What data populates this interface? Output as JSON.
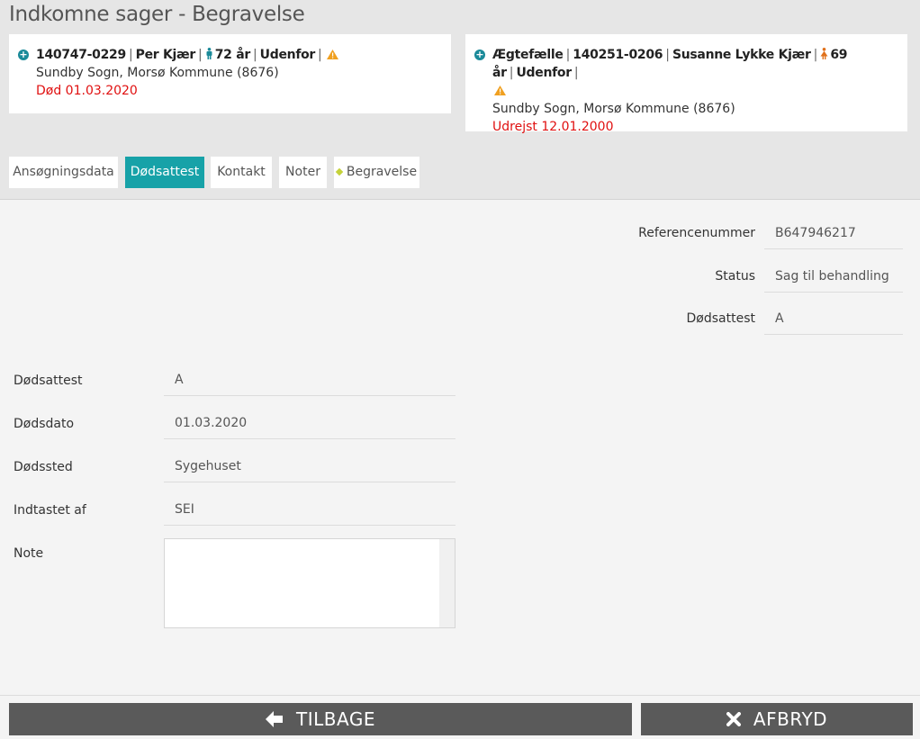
{
  "title": "Indkomne sager - Begravelse",
  "deceased": {
    "cpr": "140747-0229",
    "name": "Per Kjær",
    "age": "72 år",
    "location": "Udenfor",
    "parish": "Sundby Sogn, Morsø Kommune (8676)",
    "status": "Død 01.03.2020"
  },
  "spouse": {
    "relation": "Ægtefælle",
    "cpr": "140251-0206",
    "name": "Susanne Lykke Kjær",
    "age": "69 år",
    "location": "Udenfor",
    "parish": "Sundby Sogn, Morsø Kommune (8676)",
    "status": "Udrejst 12.01.2000"
  },
  "tabs": [
    {
      "label": "Ansøgningsdata"
    },
    {
      "label": "Dødsattest",
      "active": true
    },
    {
      "label": "Kontakt"
    },
    {
      "label": "Noter"
    },
    {
      "label": "Begravelse"
    }
  ],
  "summary": {
    "ref_label": "Referencenummer",
    "ref_value": "B647946217",
    "status_label": "Status",
    "status_value": "Sag til behandling",
    "cert_label": "Dødsattest",
    "cert_value": "A"
  },
  "form": {
    "cert_label": "Dødsattest",
    "cert_value": "A",
    "date_label": "Dødsdato",
    "date_value": "01.03.2020",
    "place_label": "Dødssted",
    "place_value": "Sygehuset",
    "entered_label": "Indtastet af",
    "entered_value": "SEI",
    "note_label": "Note",
    "note_value": ""
  },
  "buttons": {
    "back_label": "TILBAGE",
    "cancel_label": "AFBRYD"
  },
  "colors": {
    "accent": "#17a2a8",
    "danger": "#e01010",
    "warning": "#f0a020",
    "button": "#5a5a5a",
    "male_icon": "#1a8a99",
    "female_icon": "#e0701a"
  }
}
